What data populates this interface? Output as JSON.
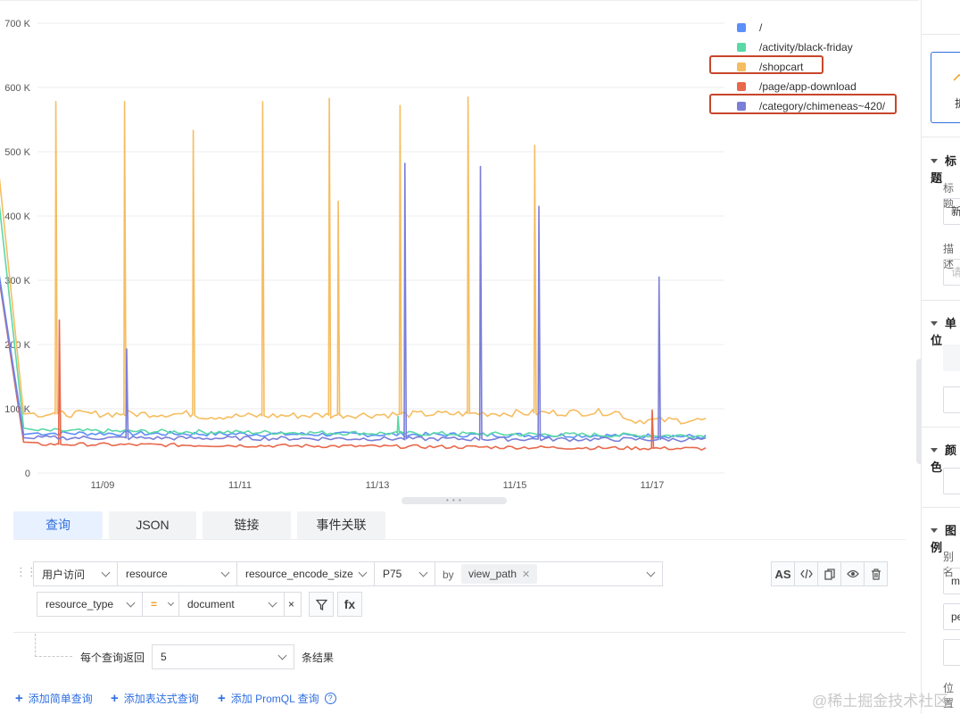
{
  "chart_data": {
    "type": "line",
    "title": "",
    "xlabel": "",
    "ylabel": "",
    "y_ticks": [
      "0",
      "100 K",
      "200 K",
      "300 K",
      "400 K",
      "500 K",
      "600 K",
      "700 K"
    ],
    "ylim": [
      0,
      700000
    ],
    "x_ticks": [
      "11/09",
      "11/11",
      "11/13",
      "11/15",
      "11/17"
    ],
    "x_tick_values": [
      1.0,
      3.0,
      5.0,
      7.0,
      9.0
    ],
    "xlim": [
      0.0,
      10.0
    ],
    "grid": true,
    "legend_position": "top-right",
    "series": [
      {
        "name": "/",
        "color": "#5b8ff9",
        "base": 62000,
        "x": [
          -0.7,
          -0.15,
          0.0,
          5.0,
          5.1,
          9.2,
          9.8
        ],
        "y": [
          445000,
          60000,
          62000,
          60000,
          60000,
          58000,
          56000
        ],
        "spikes": []
      },
      {
        "name": "/activity/black-friday",
        "color": "#5ad8a6",
        "base": 58000,
        "x": [
          -0.7,
          -0.15,
          0.0,
          9.8
        ],
        "y": [
          610000,
          70000,
          66000,
          58000
        ],
        "spikes": [
          [
            5.3,
            88000
          ]
        ]
      },
      {
        "name": "/shopcart",
        "color": "#f6bd60",
        "base": 92000,
        "x": [
          -0.7,
          -0.15,
          0.0,
          2.3,
          2.5,
          8.5,
          8.7,
          9.8
        ],
        "y": [
          665000,
          92000,
          92000,
          92000,
          88000,
          95000,
          82000,
          82000
        ],
        "spikes": [
          [
            0.32,
            578000
          ],
          [
            1.32,
            578000
          ],
          [
            2.32,
            533000
          ],
          [
            3.33,
            578000
          ],
          [
            4.3,
            583000
          ],
          [
            4.43,
            423000
          ],
          [
            5.33,
            572000
          ],
          [
            6.32,
            585000
          ],
          [
            7.29,
            510000
          ]
        ]
      },
      {
        "name": "/page/app-download",
        "color": "#e8684a",
        "base": 45000,
        "x": [
          -0.7,
          -0.15,
          0.0,
          9.8
        ],
        "y": [
          440000,
          48000,
          45000,
          38000
        ],
        "spikes": [
          [
            0.37,
            238000
          ],
          [
            9.0,
            98000
          ]
        ]
      },
      {
        "name": "/category/chimeneas~420/",
        "color": "#7a7ed8",
        "base": 55000,
        "x": [
          -0.7,
          -0.15,
          0.0,
          9.8
        ],
        "y": [
          440000,
          55000,
          55000,
          52000
        ],
        "spikes": [
          [
            1.35,
            193000
          ],
          [
            5.4,
            482000
          ],
          [
            6.5,
            477000
          ],
          [
            7.35,
            415000
          ],
          [
            9.1,
            305000
          ]
        ]
      }
    ]
  },
  "legend": {
    "items": [
      {
        "label": "/",
        "color": "#5b8ff9"
      },
      {
        "label": "/activity/black-friday",
        "color": "#5ad8a6"
      },
      {
        "label": "/shopcart",
        "color": "#f6bd60"
      },
      {
        "label": "/page/app-download",
        "color": "#e8684a"
      },
      {
        "label": "/category/chimeneas~420/",
        "color": "#7a7ed8"
      }
    ]
  },
  "tabs": [
    {
      "label": "查询",
      "active": true
    },
    {
      "label": "JSON",
      "active": false
    },
    {
      "label": "链接",
      "active": false
    },
    {
      "label": "事件关联",
      "active": false
    }
  ],
  "query": {
    "source": "用户访问",
    "measurement": "resource",
    "field": "resource_encode_size",
    "aggregate": "P75",
    "by_label": "by",
    "group_tag": "view_path",
    "filter_field": "resource_type",
    "filter_op": "=",
    "filter_value": "document",
    "filter_remove": "×",
    "fx_label": "fx",
    "as_label": "AS",
    "limit_prefix": "每个查询返回",
    "limit_value": "5",
    "limit_suffix": "条结果"
  },
  "add_links": {
    "simple": "添加简单查询",
    "expression": "添加表达式查询",
    "promql": "添加 PromQL 查询"
  },
  "right_panel": {
    "card_text": "折",
    "section_title": "标题",
    "title_label": "标题",
    "title_value": "新",
    "desc_label": "描述",
    "desc_placeholder": "请",
    "section_unit": "单位",
    "section_color": "颜色",
    "section_legend": "图例",
    "alias_label": "别名",
    "alias_value_1": "m",
    "alias_value_2": "pe",
    "position_label": "位置"
  },
  "watermark": "@稀土掘金技术社区"
}
